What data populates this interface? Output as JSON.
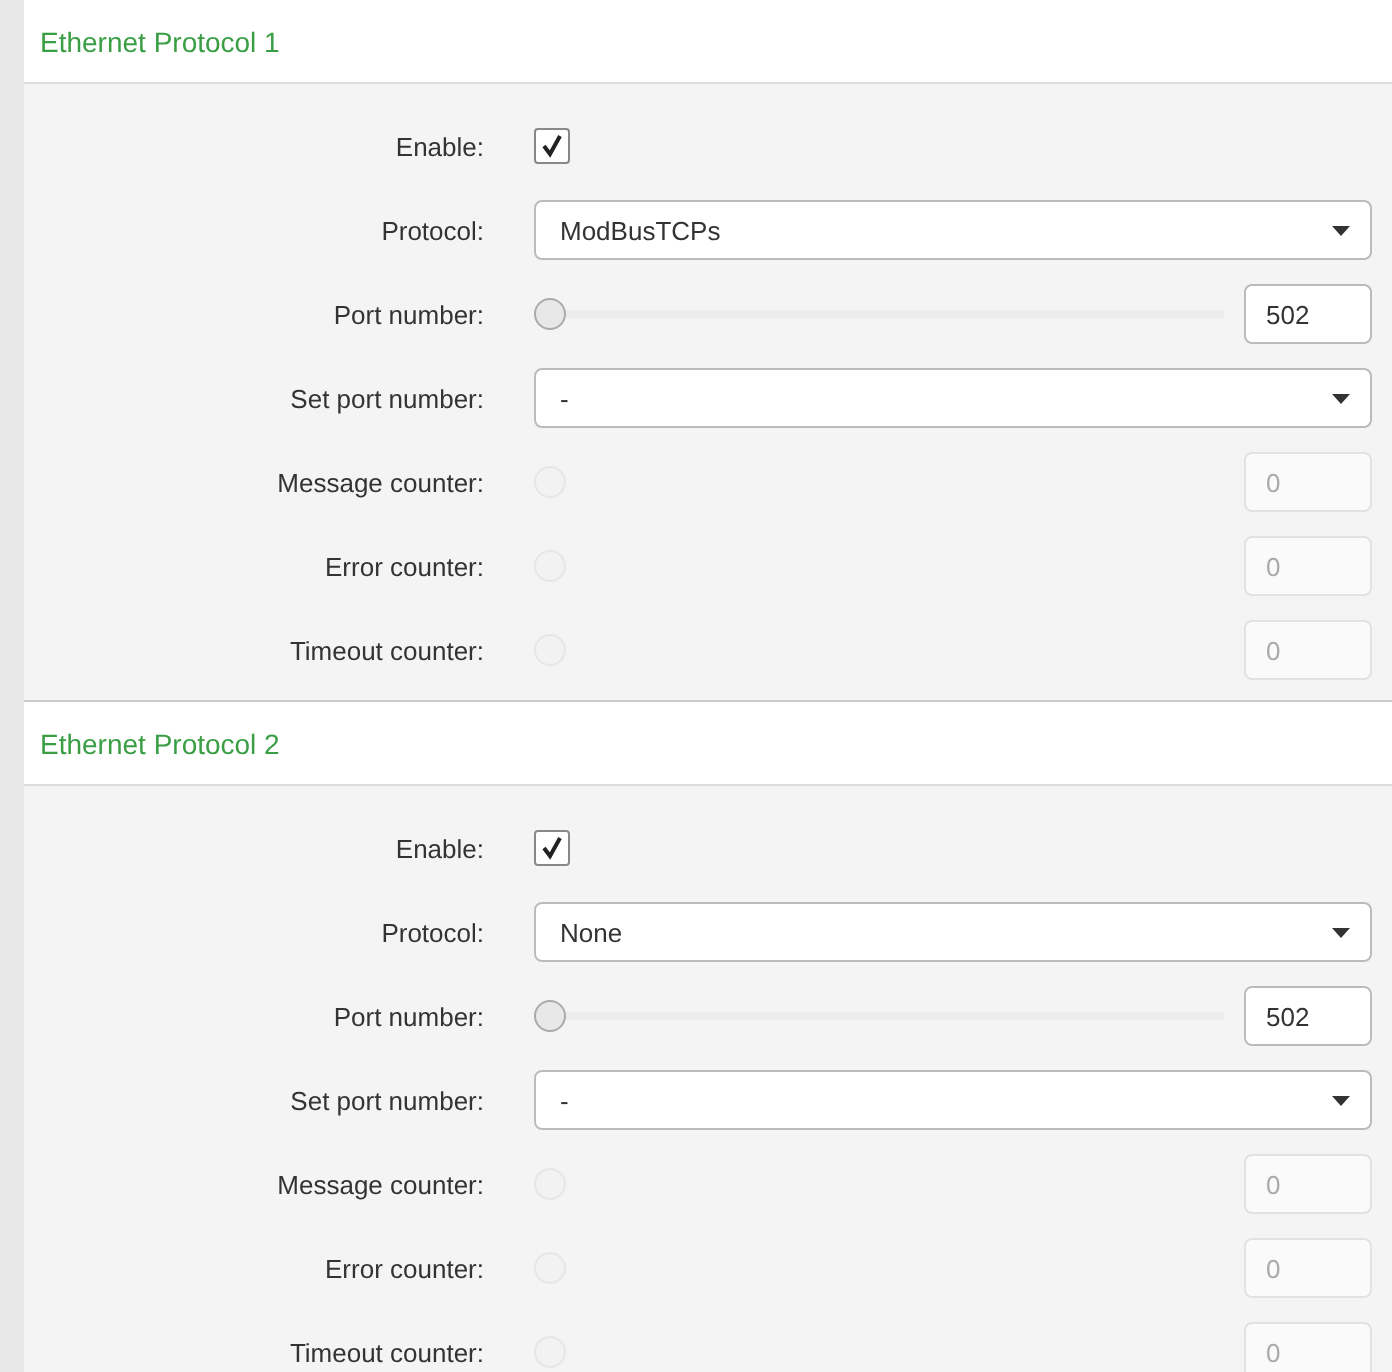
{
  "sections": [
    {
      "title": "Ethernet Protocol 1",
      "rows": [
        {
          "kind": "checkbox",
          "label": "Enable:",
          "checked": true
        },
        {
          "kind": "select",
          "label": "Protocol:",
          "value": "ModBusTCPs"
        },
        {
          "kind": "slider",
          "label": "Port number:",
          "level": 0,
          "value": "502",
          "disabled": false
        },
        {
          "kind": "select",
          "label": "Set port number:",
          "value": "-"
        },
        {
          "kind": "slider",
          "label": "Message counter:",
          "value": "0",
          "disabled": true
        },
        {
          "kind": "slider",
          "label": "Error counter:",
          "value": "0",
          "disabled": true
        },
        {
          "kind": "slider",
          "label": "Timeout counter:",
          "value": "0",
          "disabled": true
        }
      ]
    },
    {
      "title": "Ethernet Protocol 2",
      "rows": [
        {
          "kind": "checkbox",
          "label": "Enable:",
          "checked": true
        },
        {
          "kind": "select",
          "label": "Protocol:",
          "value": "None"
        },
        {
          "kind": "slider",
          "label": "Port number:",
          "level": 0,
          "value": "502",
          "disabled": false
        },
        {
          "kind": "select",
          "label": "Set port number:",
          "value": "-"
        },
        {
          "kind": "slider",
          "label": "Message counter:",
          "value": "0",
          "disabled": true
        },
        {
          "kind": "slider",
          "label": "Error counter:",
          "value": "0",
          "disabled": true
        },
        {
          "kind": "slider",
          "label": "Timeout counter:",
          "value": "0",
          "disabled": true
        }
      ]
    }
  ]
}
